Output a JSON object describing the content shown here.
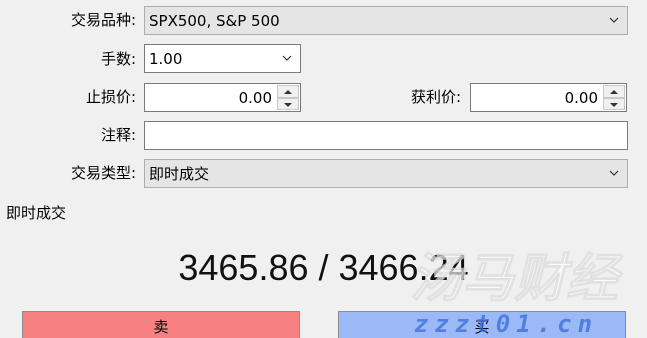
{
  "form": {
    "symbol_label": "交易品种:",
    "symbol_value": "SPX500, S&P 500",
    "volume_label": "手数:",
    "volume_value": "1.00",
    "stoploss_label": "止损价:",
    "stoploss_value": "0.00",
    "takeprofit_label": "获利价:",
    "takeprofit_value": "0.00",
    "comment_label": "注释:",
    "comment_value": "",
    "type_label": "交易类型:",
    "type_value": "即时成交"
  },
  "execution": {
    "section_title": "即时成交",
    "price_quote": "3465.86 / 3466.24",
    "sell_label": "卖",
    "buy_label": "买"
  },
  "watermark": {
    "text_main": "汤马财经",
    "text_url": "zzzt01.cn"
  },
  "colors": {
    "sell": "#f78181",
    "buy": "#9bb9f7"
  }
}
